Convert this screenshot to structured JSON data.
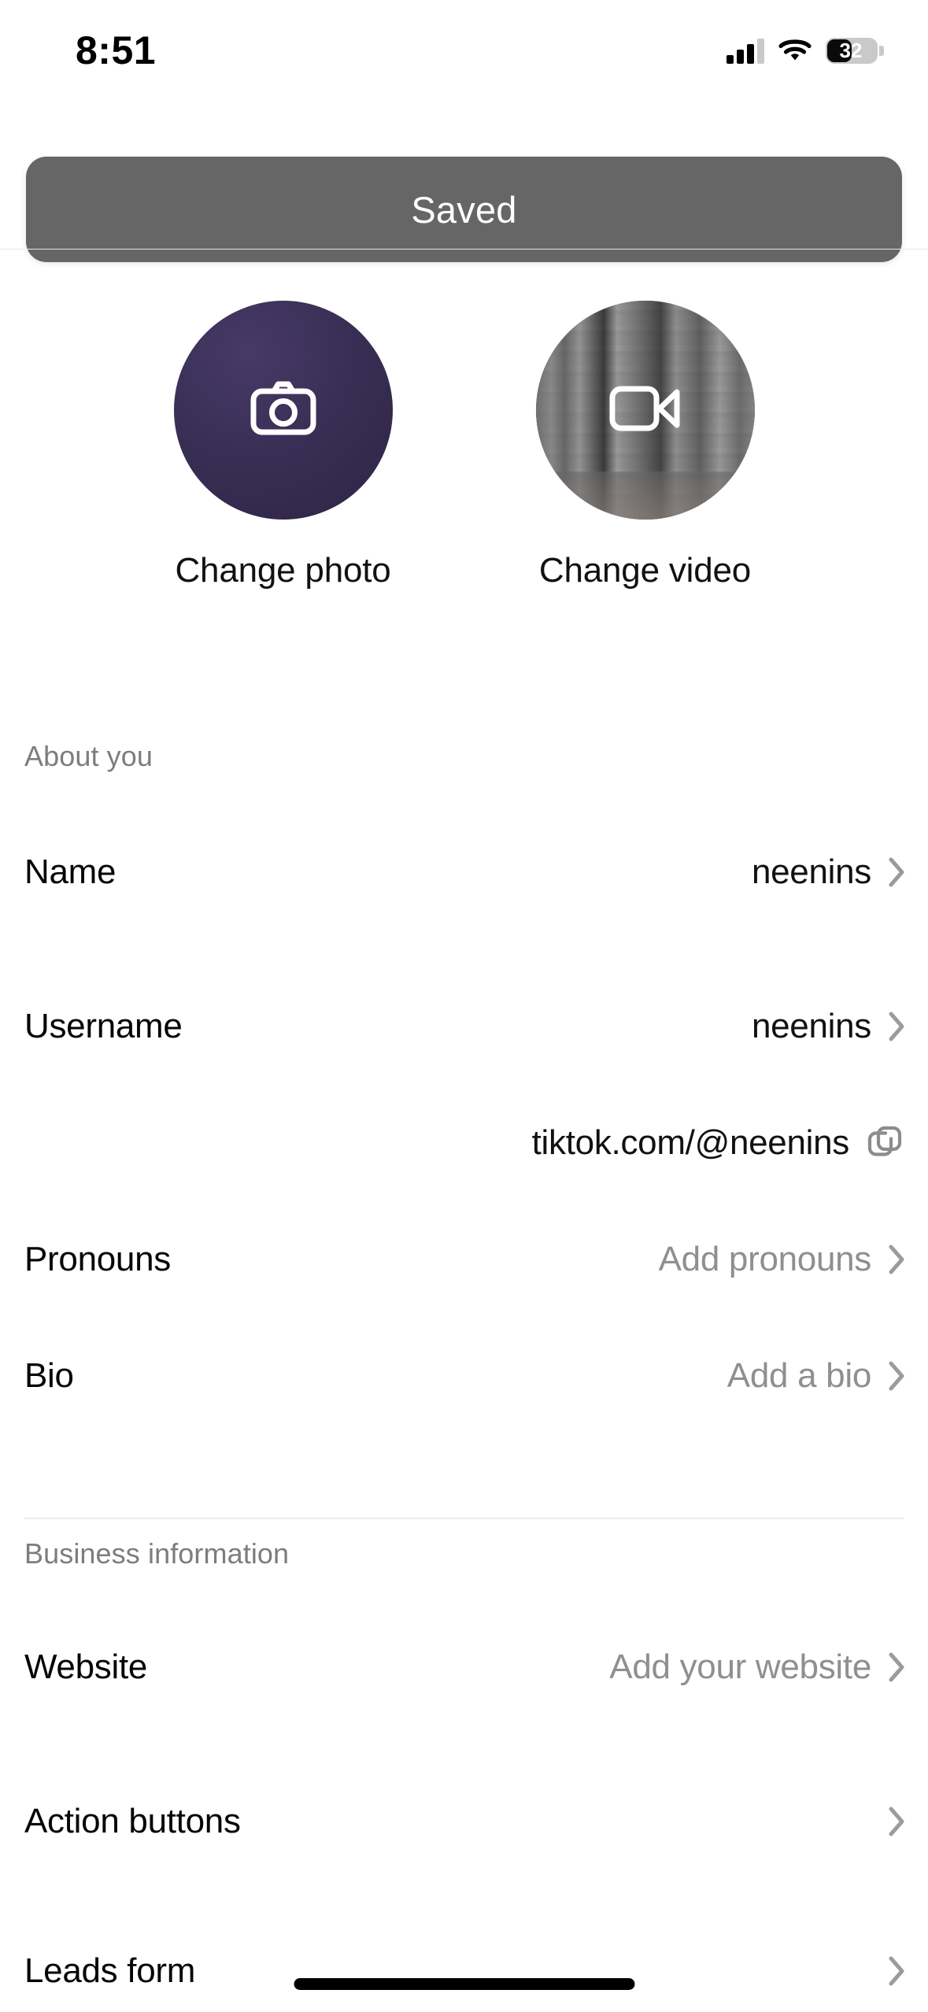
{
  "status_bar": {
    "time": "8:51",
    "battery_percent": "32",
    "signal_icon": "cellular-signal-icon",
    "wifi_icon": "wifi-icon",
    "battery_icon": "battery-icon"
  },
  "toast": {
    "message": "Saved",
    "background_color": "#666666",
    "text_color": "#ffffff"
  },
  "media": {
    "photo": {
      "label": "Change photo",
      "icon": "camera-icon",
      "background_color": "#3a3057"
    },
    "video": {
      "label": "Change video",
      "icon": "video-camera-icon",
      "background_color": "#6d6d6d"
    }
  },
  "sections": [
    {
      "title": "About you",
      "rows": [
        {
          "label": "Name",
          "value": "neenins",
          "accessory": "chevron-right-icon",
          "placeholder": false
        },
        {
          "label": "Username",
          "value": "neenins",
          "accessory": "chevron-right-icon",
          "placeholder": false
        },
        {
          "label": "",
          "value": "tiktok.com/@neenins",
          "accessory": "copy-icon",
          "placeholder": false
        },
        {
          "label": "Pronouns",
          "value": "Add pronouns",
          "accessory": "chevron-right-icon",
          "placeholder": true
        },
        {
          "label": "Bio",
          "value": "Add a bio",
          "accessory": "chevron-right-icon",
          "placeholder": true
        }
      ]
    },
    {
      "title": "Business information",
      "rows": [
        {
          "label": "Website",
          "value": "Add your website",
          "accessory": "chevron-right-icon",
          "placeholder": true
        },
        {
          "label": "Action buttons",
          "value": "",
          "accessory": "chevron-right-icon",
          "placeholder": false
        },
        {
          "label": "Leads form",
          "value": "",
          "accessory": "chevron-right-icon",
          "placeholder": false
        }
      ]
    }
  ],
  "colors": {
    "label_text": "#050505",
    "value_text": "#111111",
    "placeholder_text": "#8f8f8f",
    "section_header": "#7d7d7d",
    "divider": "#ededed",
    "chevron": "#9b9b9b"
  }
}
